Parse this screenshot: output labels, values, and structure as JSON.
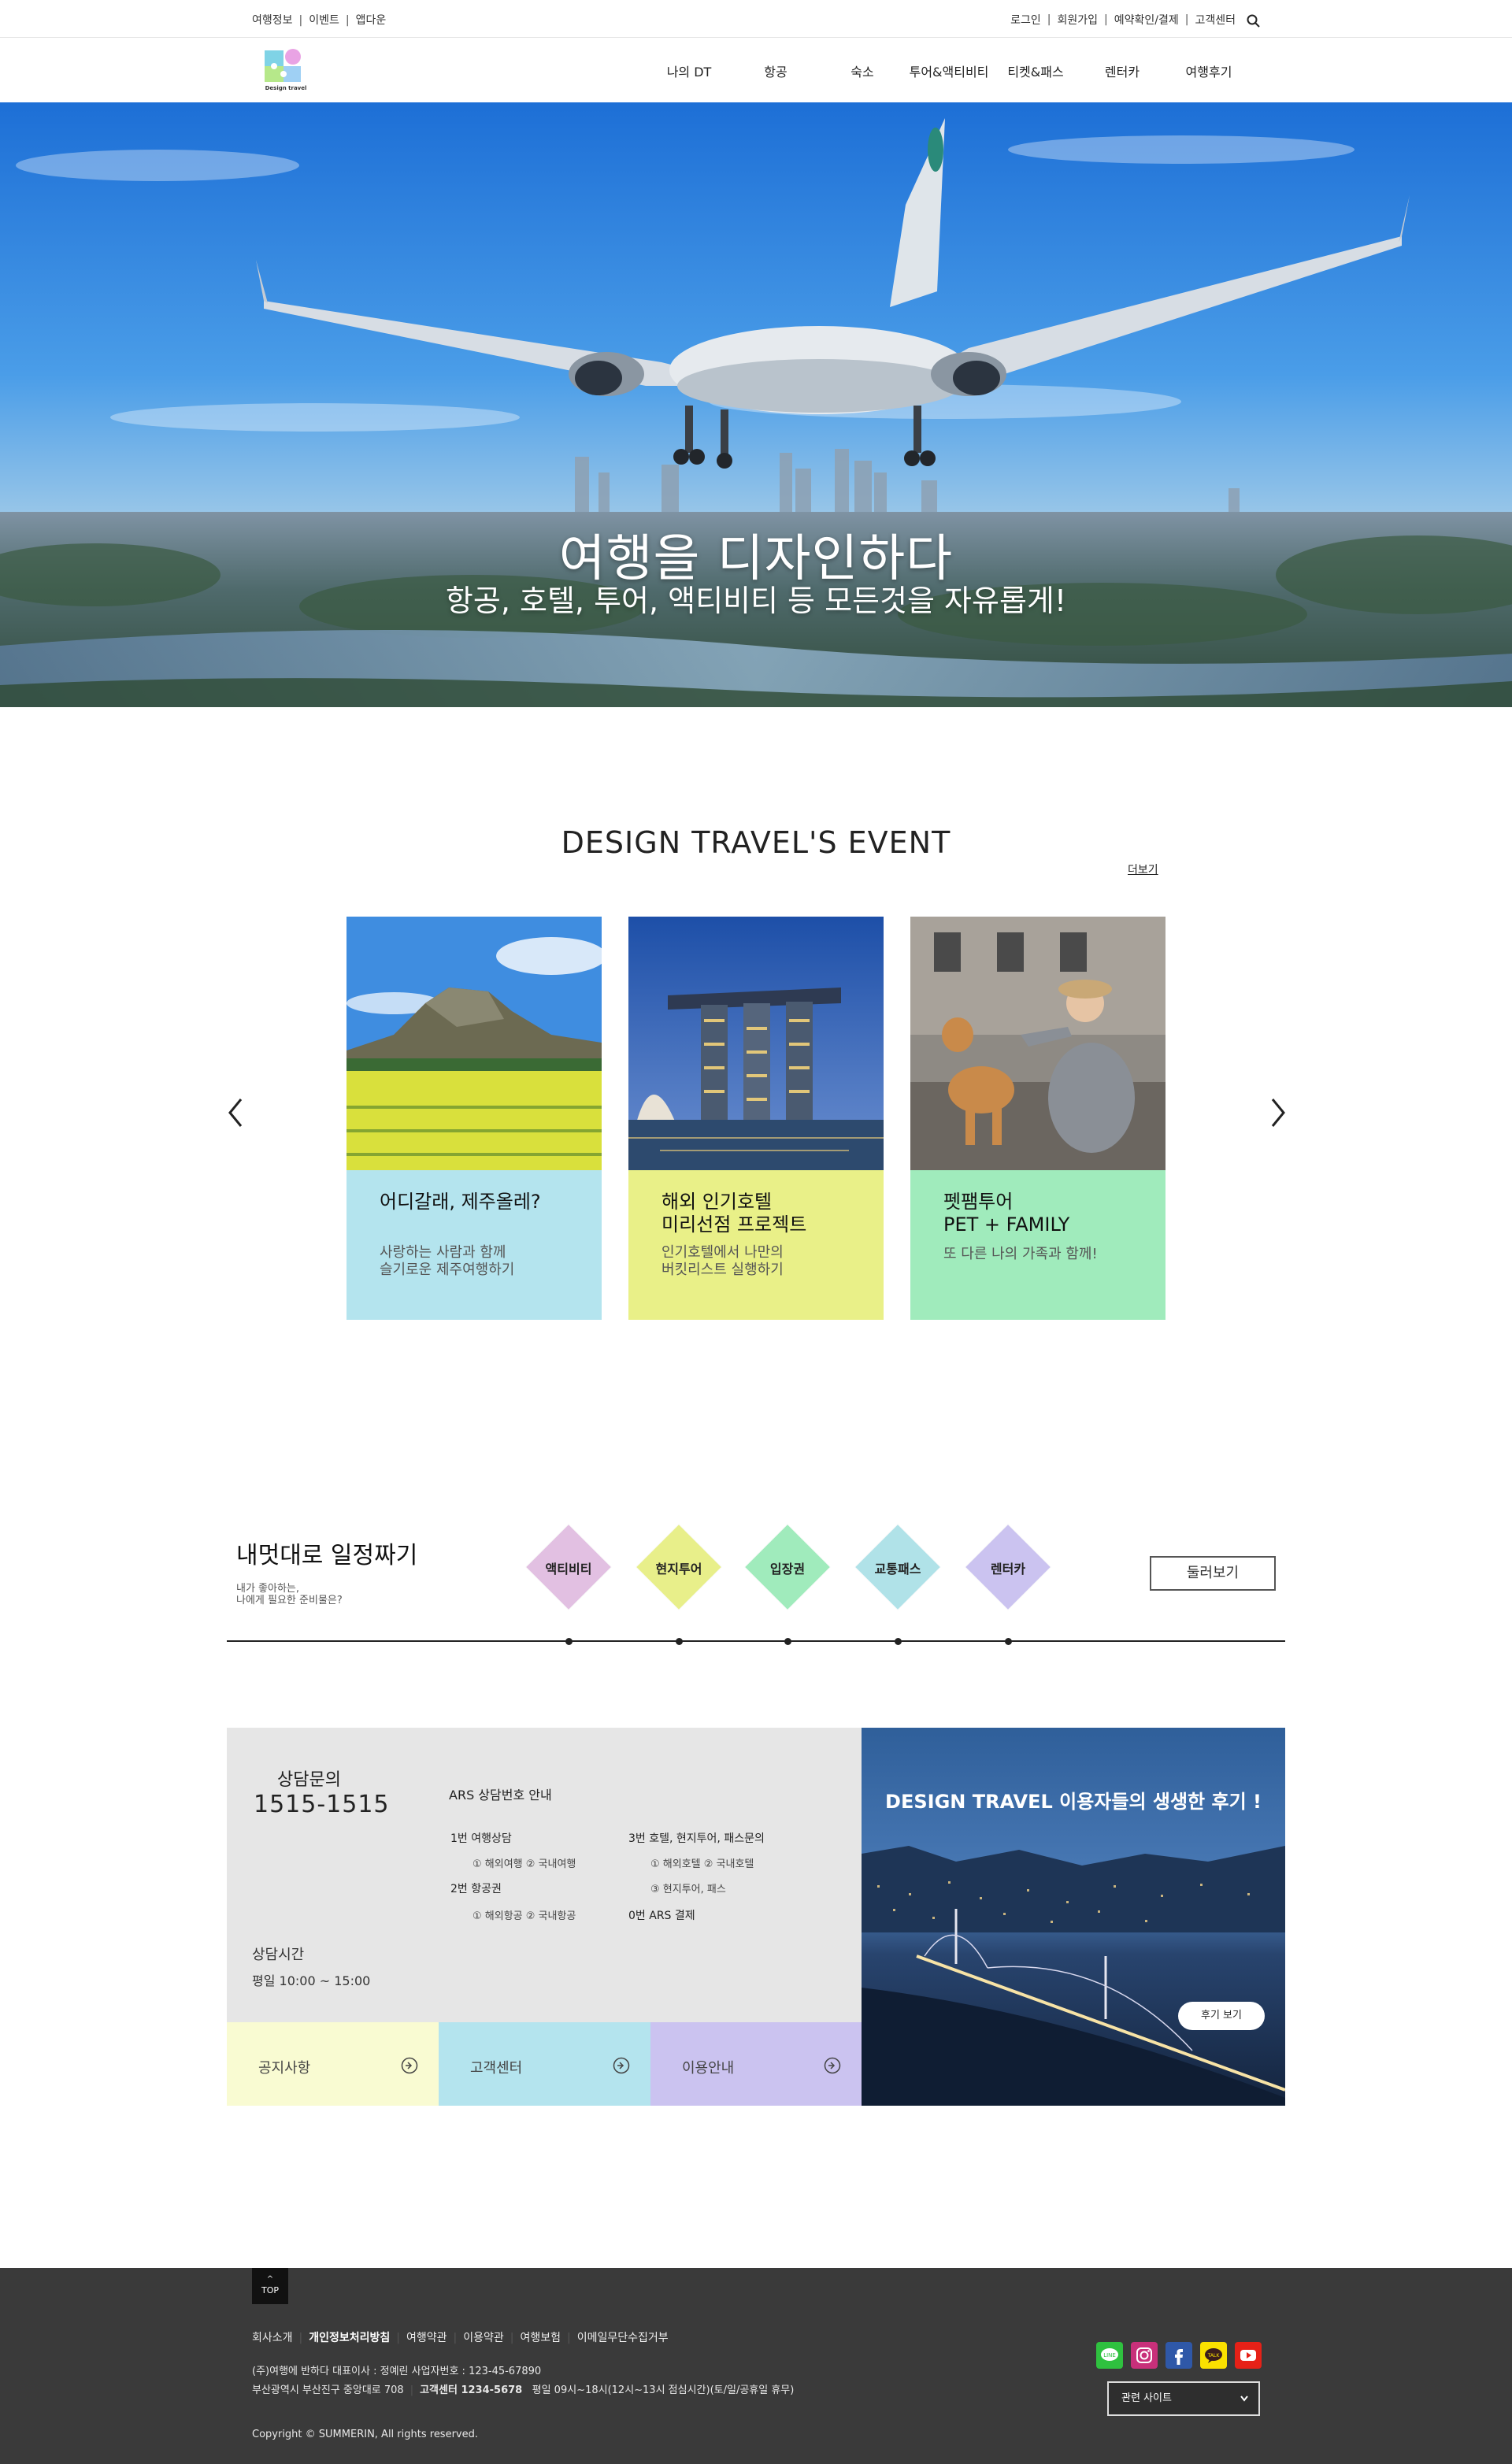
{
  "topbar": {
    "left_links": [
      "여행정보",
      "이벤트",
      "앱다운"
    ],
    "right_links": [
      "로그인",
      "회원가입",
      "예약확인/결제",
      "고객센터"
    ]
  },
  "logo": {
    "text": "Design travel"
  },
  "nav": [
    "나의 DT",
    "항공",
    "숙소",
    "투어&액티비티",
    "티켓&패스",
    "렌터카",
    "여행후기"
  ],
  "hero": {
    "title": "여행을 디자인하다",
    "subtitle": "항공, 호텔, 투어, 액티비티 등 모든것을 자유롭게!"
  },
  "events": {
    "title": "DESIGN TRAVEL'S EVENT",
    "more": "더보기",
    "cards": [
      {
        "title": "어디갈래, 제주올레?",
        "desc": "사랑하는 사람과 함께\n슬기로운 제주여행하기",
        "color": "#b4e4ee"
      },
      {
        "title": "해외 인기호텔\n미리선점 프로젝트",
        "desc": "인기호텔에서 나만의\n버킷리스트 실행하기",
        "color": "#e9f088"
      },
      {
        "title": "펫팸투어\nPET + FAMILY",
        "desc": "또 다른 나의 가족과 함께!",
        "color": "#a0ebbc"
      }
    ]
  },
  "schedule": {
    "title": "내멋대로 일정짜기",
    "subtitle": "내가 좋아하는,\n나에게 필요한 준비물은?",
    "items": [
      {
        "label": "액티비티",
        "color": "#e2c0e2"
      },
      {
        "label": "현지투어",
        "color": "#e8ef8a"
      },
      {
        "label": "입장권",
        "color": "#a0ebbc"
      },
      {
        "label": "교통패스",
        "color": "#b0e2e8"
      },
      {
        "label": "렌터카",
        "color": "#cbc3f0"
      }
    ],
    "button": "둘러보기"
  },
  "consult": {
    "label": "상담문의",
    "phone": "1515-1515",
    "ars_title": "ARS 상담번호 안내",
    "ars_items": {
      "a1": "1번 여행상담",
      "a1s": "① 해외여행 ② 국내여행",
      "a2": "2번 항공권",
      "a2s": "① 해외항공 ② 국내항공",
      "b1": "3번 호텔, 현지투어, 패스문의",
      "b1s": "① 해외호텔 ② 국내호텔",
      "b1s2": "③ 현지투어, 패스",
      "b2": "0번 ARS 결제"
    },
    "time_label": "상담시간",
    "time": "평일 10:00 ~ 15:00"
  },
  "quick_links": [
    {
      "label": "공지사항",
      "color": "#f9fbd2"
    },
    {
      "label": "고객센터",
      "color": "#b4e4ee"
    },
    {
      "label": "이용안내",
      "color": "#cbc3f0"
    }
  ],
  "review": {
    "title": "DESIGN TRAVEL 이용자들의 생생한 후기 !",
    "button": "후기 보기"
  },
  "footer": {
    "top_label": "TOP",
    "links": [
      "회사소개",
      "개인정보처리방침",
      "여행약관",
      "이용약관",
      "여행보험",
      "이메일무단수집거부"
    ],
    "info1": "(주)여행에 반하다 대표이사 : 정예린 사업자번호 : 123-45-67890",
    "info2_a": "부산광역시 부산진구 중앙대로 708",
    "info2_b": "고객센터 1234-5678",
    "info2_c": "평일 09시~18시(12시~13시 점심시간)(토/일/공휴일 휴무)",
    "copyright": "Copyright © SUMMERIN, All rights reserved.",
    "related": "관련 사이트",
    "social": [
      {
        "name": "line-icon",
        "color": "#2fc13f"
      },
      {
        "name": "instagram-icon",
        "color": "#c8307a"
      },
      {
        "name": "facebook-icon",
        "color": "#2f58a8"
      },
      {
        "name": "kakaotalk-icon",
        "color": "#fae100"
      },
      {
        "name": "youtube-icon",
        "color": "#e62117"
      }
    ]
  }
}
